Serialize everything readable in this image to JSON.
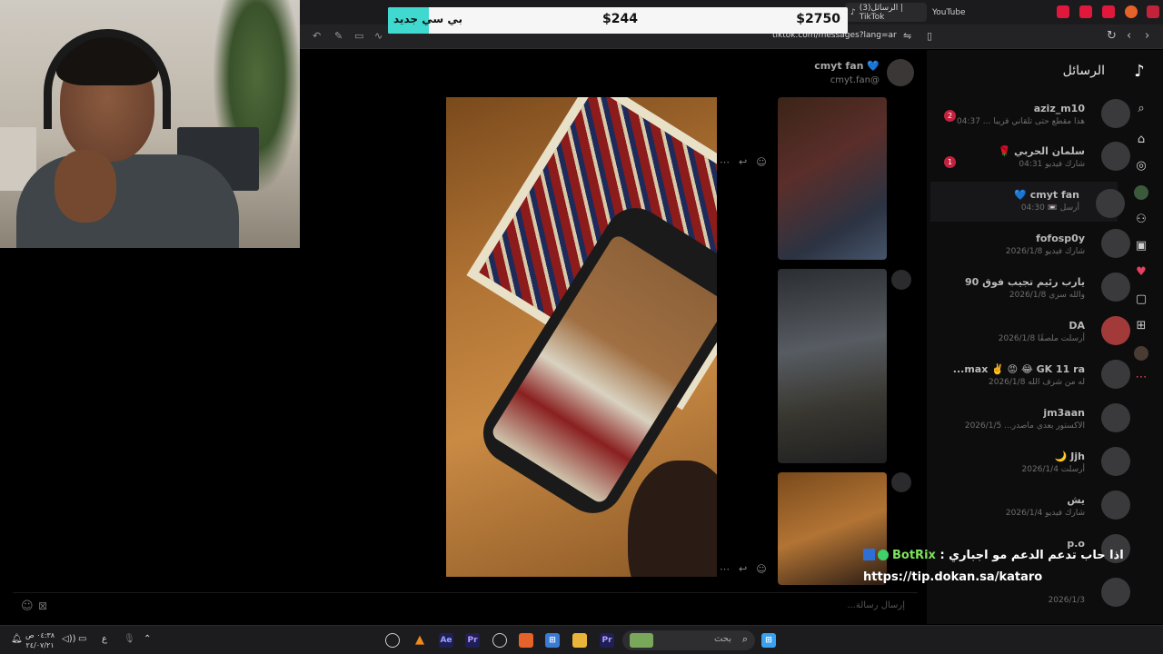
{
  "browser": {
    "tabs": [
      {
        "label": "(3)الرسائل | TikTok"
      },
      {
        "label": "YouTube"
      }
    ],
    "url": "tiktok.com/messages?lang=ar"
  },
  "banner": {
    "label": "بي سي جديد",
    "current": "$244",
    "goal": "$2750",
    "progress": 0.089
  },
  "sidebar": {
    "title": "الرسائل"
  },
  "conversations": [
    {
      "name": "aziz_m10",
      "sub": "هذا مقطع حتى تلقاني قريبا ... 04:37",
      "unread": "2"
    },
    {
      "name": "سلمان الحربي 🌹",
      "sub": "شارك فيديو 04:31",
      "unread": "1"
    },
    {
      "name": "cmyt fan 💙",
      "sub": "أرسل 📼 04:30",
      "unread": ""
    },
    {
      "name": "fofosp0y",
      "sub": "شارك فيديو 2026/1/8",
      "unread": ""
    },
    {
      "name": "يارب رئيم تجيب فوق 90",
      "sub": "والله سري 2026/1/8",
      "unread": ""
    },
    {
      "name": "DA",
      "sub": "أرسلت ملصقًا 2026/1/8",
      "unread": ""
    },
    {
      "name": "max ✌️ 😡 😂 GK 11 ra...",
      "sub": "له من شرف الله 2026/1/8",
      "unread": ""
    },
    {
      "name": "jm3aan",
      "sub": "الاكستور بعدي ماصدر... 2026/1/5",
      "unread": ""
    },
    {
      "name": "Jjh 🌙",
      "sub": "أرسلت 2026/1/4",
      "unread": ""
    },
    {
      "name": "يش",
      "sub": "شارك فيديو 2026/1/4",
      "unread": ""
    },
    {
      "name": "p.o",
      "sub": "",
      "unread": ""
    },
    {
      "name": "",
      "sub": "2026/1/3",
      "unread": ""
    }
  ],
  "chat": {
    "name": "cmyt fan 💙",
    "handle": "cmyt.fan@",
    "composer_placeholder": "إرسال رسالة..."
  },
  "overlay": {
    "botrix_name": "BotRix",
    "botrix_message": "اذا حاب تدعم الدعم مو اجباري :",
    "link": "https://tip.dokan.sa/kataro"
  },
  "taskbar": {
    "search_placeholder": "بحث",
    "time": "٠٤:٣٨ ص",
    "date": "٢٤/٠٧/٢١",
    "lang": "ع"
  }
}
